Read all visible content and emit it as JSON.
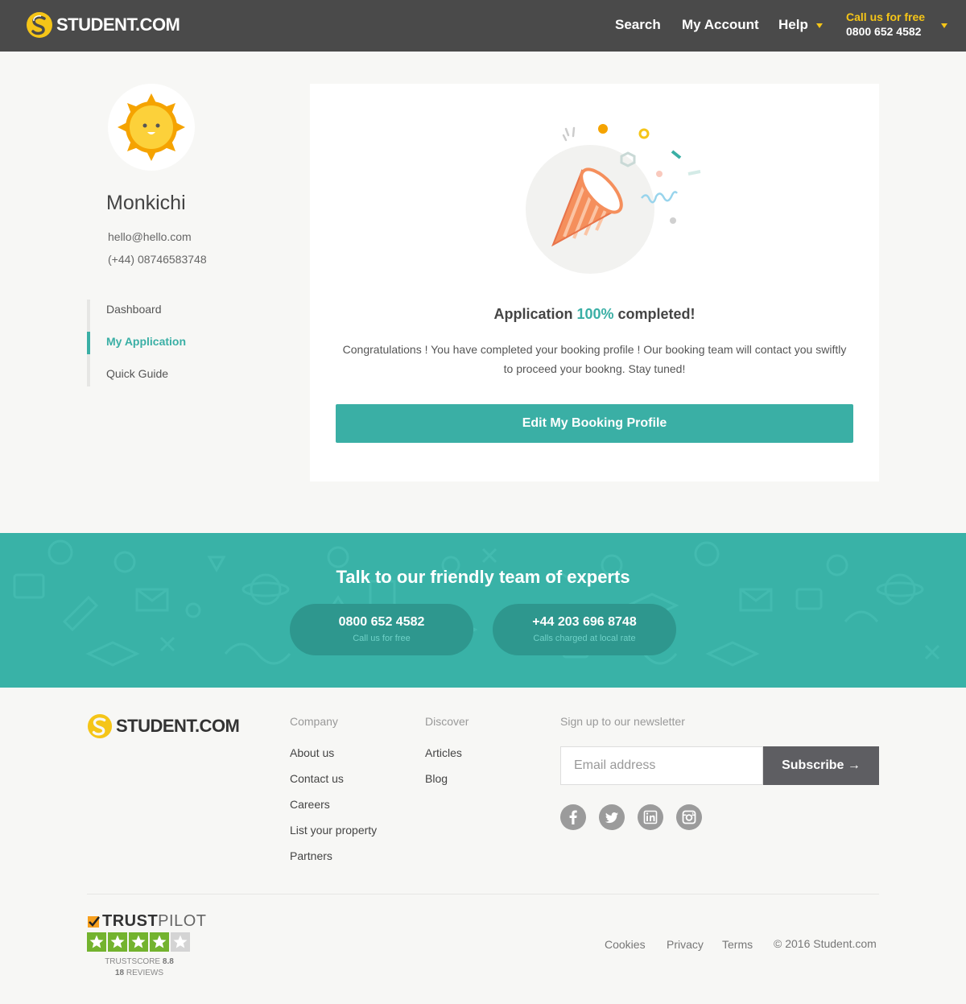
{
  "header": {
    "brand": "STUDENT.COM",
    "nav": [
      "Search",
      "My Account",
      "Help"
    ],
    "call_label": "Call us for free",
    "call_number": "0800 652 4582"
  },
  "profile": {
    "name": "Monkichi",
    "email": "hello@hello.com",
    "phone": "(+44) 08746583748",
    "menu": [
      {
        "label": "Dashboard"
      },
      {
        "label": "My Application"
      },
      {
        "label": "Quick Guide"
      }
    ],
    "active_index": 1
  },
  "completion": {
    "title_prefix": "Application",
    "percent": "100%",
    "title_suffix": "completed!",
    "message": "Congratulations ! You have completed your booking profile ! Our booking team will contact you swiftly to proceed your bookng. Stay tuned!",
    "button": "Edit My Booking Profile"
  },
  "banner": {
    "title": "Talk to our friendly team of experts",
    "phones": [
      {
        "number": "0800 652 4582",
        "caption": "Call us for free"
      },
      {
        "number": "+44 203 696 8748",
        "caption": "Calls charged at local rate"
      }
    ]
  },
  "footer": {
    "brand": "STUDENT.COM",
    "company": {
      "heading": "Company",
      "links": [
        "About us",
        "Contact us",
        "Careers",
        "List your property",
        "Partners"
      ]
    },
    "discover": {
      "heading": "Discover",
      "links": [
        "Articles",
        "Blog"
      ]
    },
    "newsletter": {
      "heading": "Sign up to our newsletter",
      "placeholder": "Email address",
      "button": "Subscribe"
    },
    "social": [
      "facebook-icon",
      "twitter-icon",
      "linkedin-icon",
      "instagram-icon"
    ],
    "trustpilot": {
      "brand_bold": "TRUST",
      "brand_light": "PILOT",
      "score_label": "TRUSTSCORE",
      "score": "8.8",
      "reviews_count": "18",
      "reviews_label": "REVIEWS",
      "rating": 4
    },
    "legal": [
      "Cookies",
      "Privacy",
      "Terms"
    ],
    "copyright": "© 2016 Student.com"
  },
  "colors": {
    "accent": "#3aafa5",
    "header_bg": "#4a4a4a",
    "brand_yellow": "#f5c518",
    "banner_bg": "#39b2a7"
  }
}
